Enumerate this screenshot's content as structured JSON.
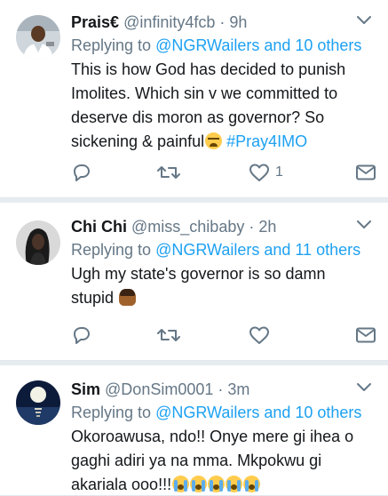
{
  "tweets": [
    {
      "name": "Prais€",
      "handle": "@infinity4fcb",
      "separator": "·",
      "time": "9h",
      "replying_prefix": "Replying to ",
      "replying_to": "@NGRWailers and 10 others",
      "body_lines": [
        "This is how God has decided to punish",
        "Imolites. Which sin v we committed to",
        "deserve dis moron as governor? So",
        "sickening & painful"
      ],
      "hashtag": "#Pray4IMO",
      "emoji": [
        "crying-face"
      ],
      "like_count": "1",
      "avatar_colors": {
        "bg": "#cfd6dc",
        "skin": "#5a3a24",
        "shirt": "#ffffff"
      }
    },
    {
      "name": "Chi Chi",
      "handle": "@miss_chibaby",
      "separator": "·",
      "time": "2h",
      "replying_prefix": "Replying to ",
      "replying_to": "@NGRWailers and 11 others",
      "body_lines": [
        "Ugh my state's governor is so damn",
        "stupid"
      ],
      "emoji": [
        "facepalm"
      ],
      "like_count": "",
      "avatar_colors": {
        "bg": "#d9d9d9",
        "hair": "#1a1a1a",
        "skin": "#4a3328"
      }
    },
    {
      "name": "Sim",
      "handle": "@DonSim0001",
      "separator": "·",
      "time": "3m",
      "replying_prefix": "Replying to ",
      "replying_to": "@NGRWailers and 10 others",
      "body_lines": [
        "Okoroawusa, ndo!! Onye mere gi ihea o",
        "gaghi adiri ya na mma. Mkpokwu gi",
        "akariala ooo!!!"
      ],
      "emoji": [
        "loudly-crying-face",
        "loudly-crying-face",
        "loudly-crying-face",
        "loudly-crying-face",
        "loudly-crying-face"
      ],
      "avatar_colors": {
        "sky": "#0d1b3a",
        "moon": "#f2f2e6",
        "water": "#1f3a66"
      }
    }
  ],
  "icons": {
    "reply": "reply-icon",
    "retweet": "retweet-icon",
    "like": "heart-icon",
    "dm": "envelope-icon",
    "caret": "chevron-down-icon"
  },
  "colors": {
    "link": "#1da1f2",
    "muted": "#657786",
    "text": "#14171a",
    "divider": "#e6ecf0"
  }
}
